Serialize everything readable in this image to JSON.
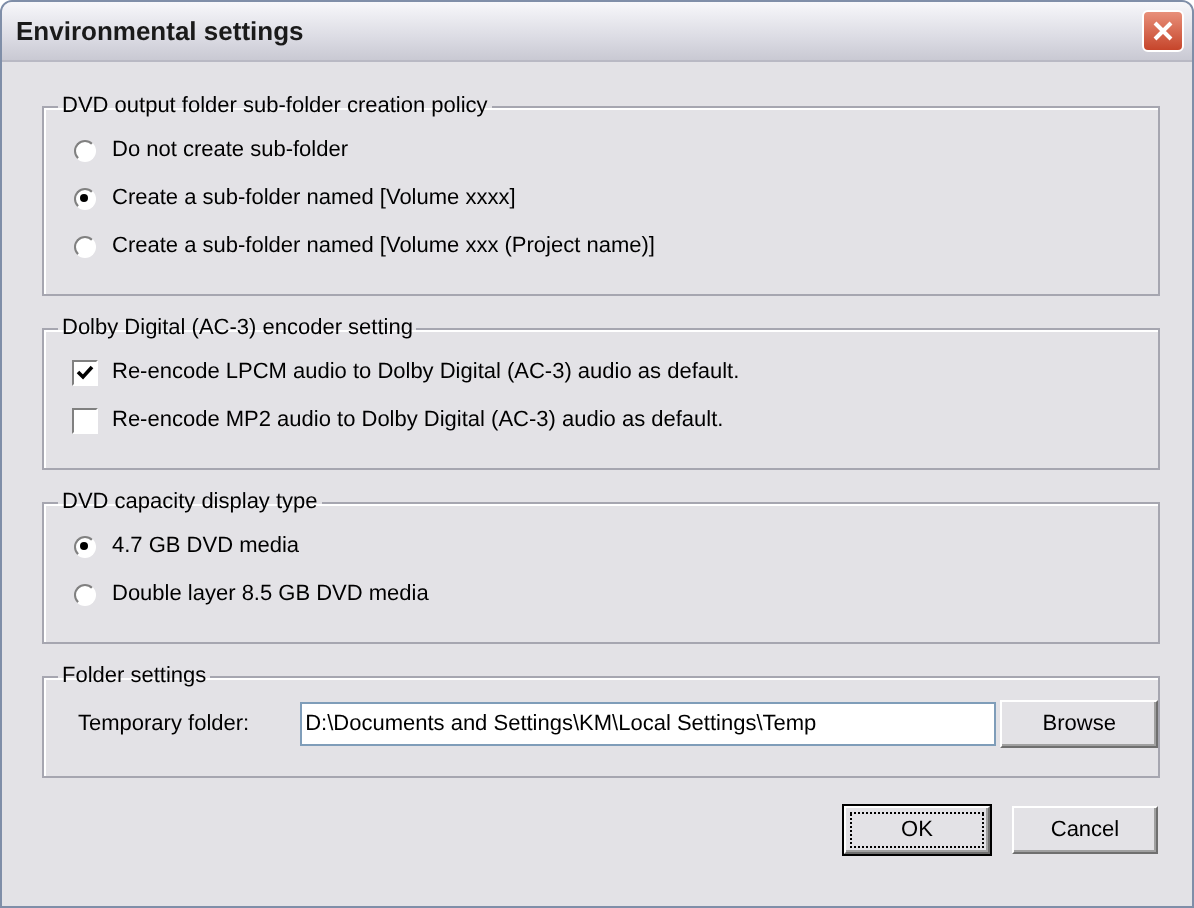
{
  "window": {
    "title": "Environmental settings"
  },
  "groups": [
    {
      "title": "DVD output folder sub-folder creation policy",
      "options": [
        {
          "kind": "radio",
          "label": "Do not create sub-folder",
          "selected": false
        },
        {
          "kind": "radio",
          "label": "Create a sub-folder named [Volume xxxx]",
          "selected": true
        },
        {
          "kind": "radio",
          "label": "Create a sub-folder named [Volume xxx (Project name)]",
          "selected": false
        }
      ]
    },
    {
      "title": "Dolby Digital (AC-3) encoder setting",
      "options": [
        {
          "kind": "checkbox",
          "label": "Re-encode LPCM audio to Dolby Digital (AC-3) audio as default.",
          "checked": true
        },
        {
          "kind": "checkbox",
          "label": "Re-encode MP2 audio to Dolby Digital (AC-3) audio as default.",
          "checked": false
        }
      ]
    },
    {
      "title": "DVD capacity display type",
      "options": [
        {
          "kind": "radio",
          "label": "4.7 GB DVD media",
          "selected": true
        },
        {
          "kind": "radio",
          "label": "Double layer 8.5 GB DVD media",
          "selected": false
        }
      ]
    }
  ],
  "folder_settings": {
    "title": "Folder settings",
    "label": "Temporary folder:",
    "value": "D:\\Documents and Settings\\KM\\Local Settings\\Temp",
    "button": "Browse"
  },
  "buttons": [
    {
      "label": "OK",
      "focused": true
    },
    {
      "label": "Cancel",
      "focused": false
    }
  ]
}
